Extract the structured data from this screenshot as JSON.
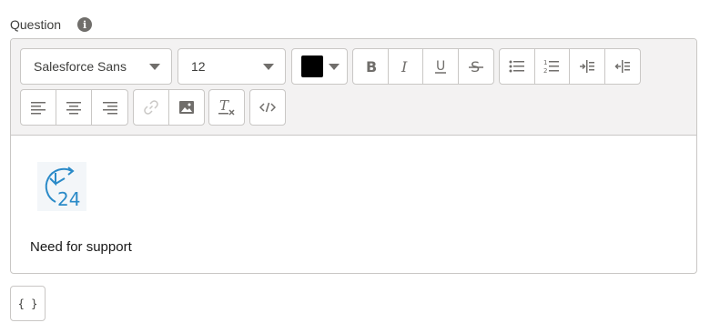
{
  "field": {
    "label": "Question",
    "info_icon": "info-icon"
  },
  "toolbar": {
    "font_family": "Salesforce Sans",
    "font_size": "12",
    "text_color": "#000000",
    "format_buttons": [
      "bold-icon",
      "italic-icon",
      "underline-icon",
      "strikethrough-icon"
    ],
    "list_buttons": [
      "bulleted-list-icon",
      "numbered-list-icon",
      "indent-icon",
      "outdent-icon"
    ],
    "align_buttons": [
      "align-left-icon",
      "align-center-icon",
      "align-right-icon"
    ],
    "insert_buttons": [
      "link-icon",
      "image-icon"
    ],
    "clear_format_icon": "clear-formatting-icon",
    "source_icon": "code-view-icon"
  },
  "content": {
    "image_icon": "24-hour-support-icon",
    "text": "Need for support"
  },
  "merge_field": {
    "label": "{ }"
  }
}
